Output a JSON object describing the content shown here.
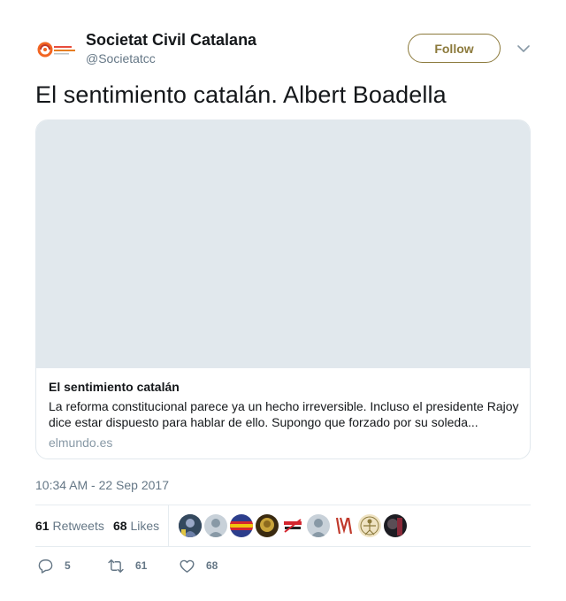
{
  "author": {
    "name": "Societat Civil Catalana",
    "handle": "@Societatcc"
  },
  "follow_label": "Follow",
  "tweet": {
    "text": "El sentimiento catalán. Albert Boadella"
  },
  "card": {
    "title": "El sentimiento catalán",
    "description": "La reforma constitucional parece ya un hecho irreversible. Incluso el presidente Rajoy dice estar dispuesto para hablar de ello. Supongo que forzado por su soleda...",
    "domain": "elmundo.es"
  },
  "timestamp": "10:34 AM - 22 Sep 2017",
  "stats": {
    "retweets_count": "61",
    "retweets_label": "Retweets",
    "likes_count": "68",
    "likes_label": "Likes"
  },
  "actions": {
    "reply_count": "5",
    "retweet_count": "61",
    "like_count": "68"
  },
  "colors": {
    "accent": "#8c7a3c",
    "secondary_text": "#657786",
    "image_placeholder": "#e1e8ed",
    "logo_orange": "#f26522"
  },
  "icons": [
    "logo-icon",
    "chevron-down-icon",
    "reply-icon",
    "retweet-icon",
    "heart-icon"
  ]
}
